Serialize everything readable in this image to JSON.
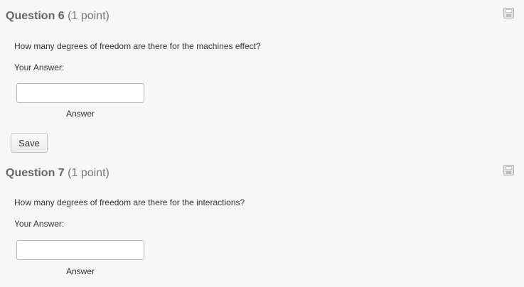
{
  "questions": [
    {
      "number_label": "Question 6",
      "points_label": "(1 point)",
      "prompt": "How many degrees of freedom are there for the machines effect?",
      "your_answer_label": "Your Answer:",
      "answer_value": "",
      "answer_caption": "Answer",
      "save_icon": "floppy-disk-icon"
    },
    {
      "number_label": "Question 7",
      "points_label": "(1 point)",
      "prompt": "How many degrees of freedom are there for the interactions?",
      "your_answer_label": "Your Answer:",
      "answer_value": "",
      "answer_caption": "Answer",
      "save_icon": "floppy-disk-icon"
    }
  ],
  "save_button_label": "Save"
}
